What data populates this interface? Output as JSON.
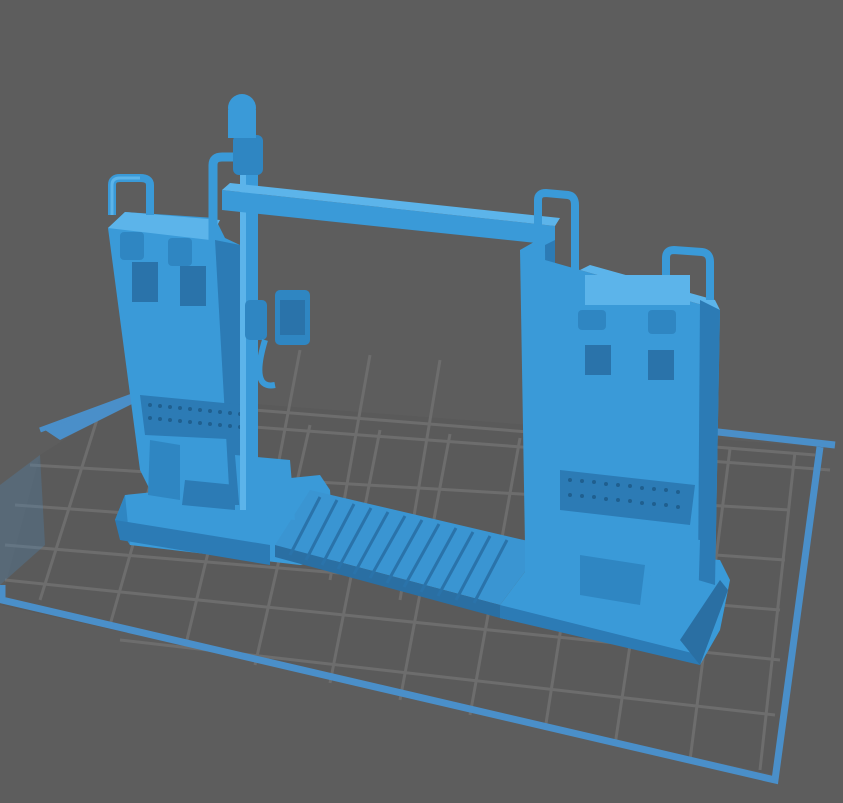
{
  "viewport": {
    "background_color": "#5d5d5d",
    "bed_outline_color": "#4a8fc9",
    "bed_grid_color": "#6e6e6e",
    "model_color": "#3a9ad8",
    "model_shadow_color": "#2a6fa3",
    "model_highlight_color": "#5cb4ea",
    "bed_grid_visible": true
  },
  "model": {
    "icon": "gate-3d-model",
    "parts": [
      "left-pillar",
      "right-pillar",
      "top-beam",
      "antenna-lamp",
      "control-box",
      "floor-grate",
      "base-plinth"
    ]
  }
}
